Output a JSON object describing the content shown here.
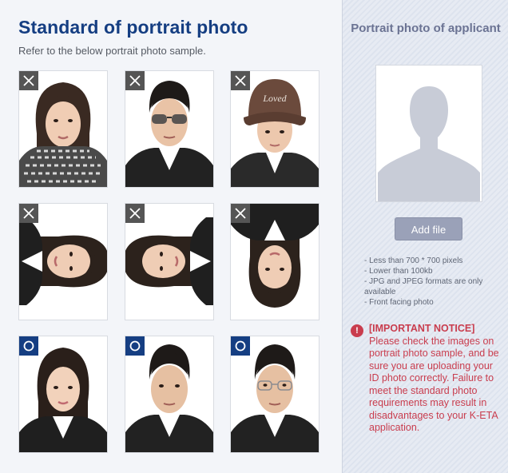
{
  "main": {
    "title": "Standard of portrait photo",
    "subtitle": "Refer to the below portrait photo sample."
  },
  "samples": [
    {
      "row": 1,
      "status": "x",
      "status_icon": "cross-icon",
      "note": "scarf"
    },
    {
      "row": 1,
      "status": "x",
      "status_icon": "cross-icon",
      "note": "sunglasses"
    },
    {
      "row": 1,
      "status": "x",
      "status_icon": "cross-icon",
      "note": "hat"
    },
    {
      "row": 2,
      "status": "x",
      "status_icon": "cross-icon",
      "note": "rotated right"
    },
    {
      "row": 2,
      "status": "x",
      "status_icon": "cross-icon",
      "note": "rotated left"
    },
    {
      "row": 2,
      "status": "x",
      "status_icon": "cross-icon",
      "note": "upside down"
    },
    {
      "row": 3,
      "status": "o",
      "status_icon": "circle-icon"
    },
    {
      "row": 3,
      "status": "o",
      "status_icon": "circle-icon"
    },
    {
      "row": 3,
      "status": "o",
      "status_icon": "circle-icon"
    }
  ],
  "upload": {
    "title": "Portrait photo of applicant",
    "placeholder_icon": "person-silhouette-icon",
    "button_label": "Add file",
    "requirements": [
      "- Less than 700 * 700 pixels",
      "- Lower than 100kb",
      "- JPG and JPEG formats are only available",
      "- Front facing photo"
    ]
  },
  "notice": {
    "icon": "!",
    "heading": "[IMPORTANT NOTICE]",
    "body": "Please check the images on portrait photo sample, and be sure you are uploading your ID photo correctly. Failure to meet the standard photo requirements may result in disadvantages to your K-ETA application."
  },
  "colors": {
    "title": "#153e82",
    "reject_mark": "#555555",
    "accept_mark": "#153e82",
    "notice": "#c93d4e",
    "button": "#9aa1b8"
  }
}
